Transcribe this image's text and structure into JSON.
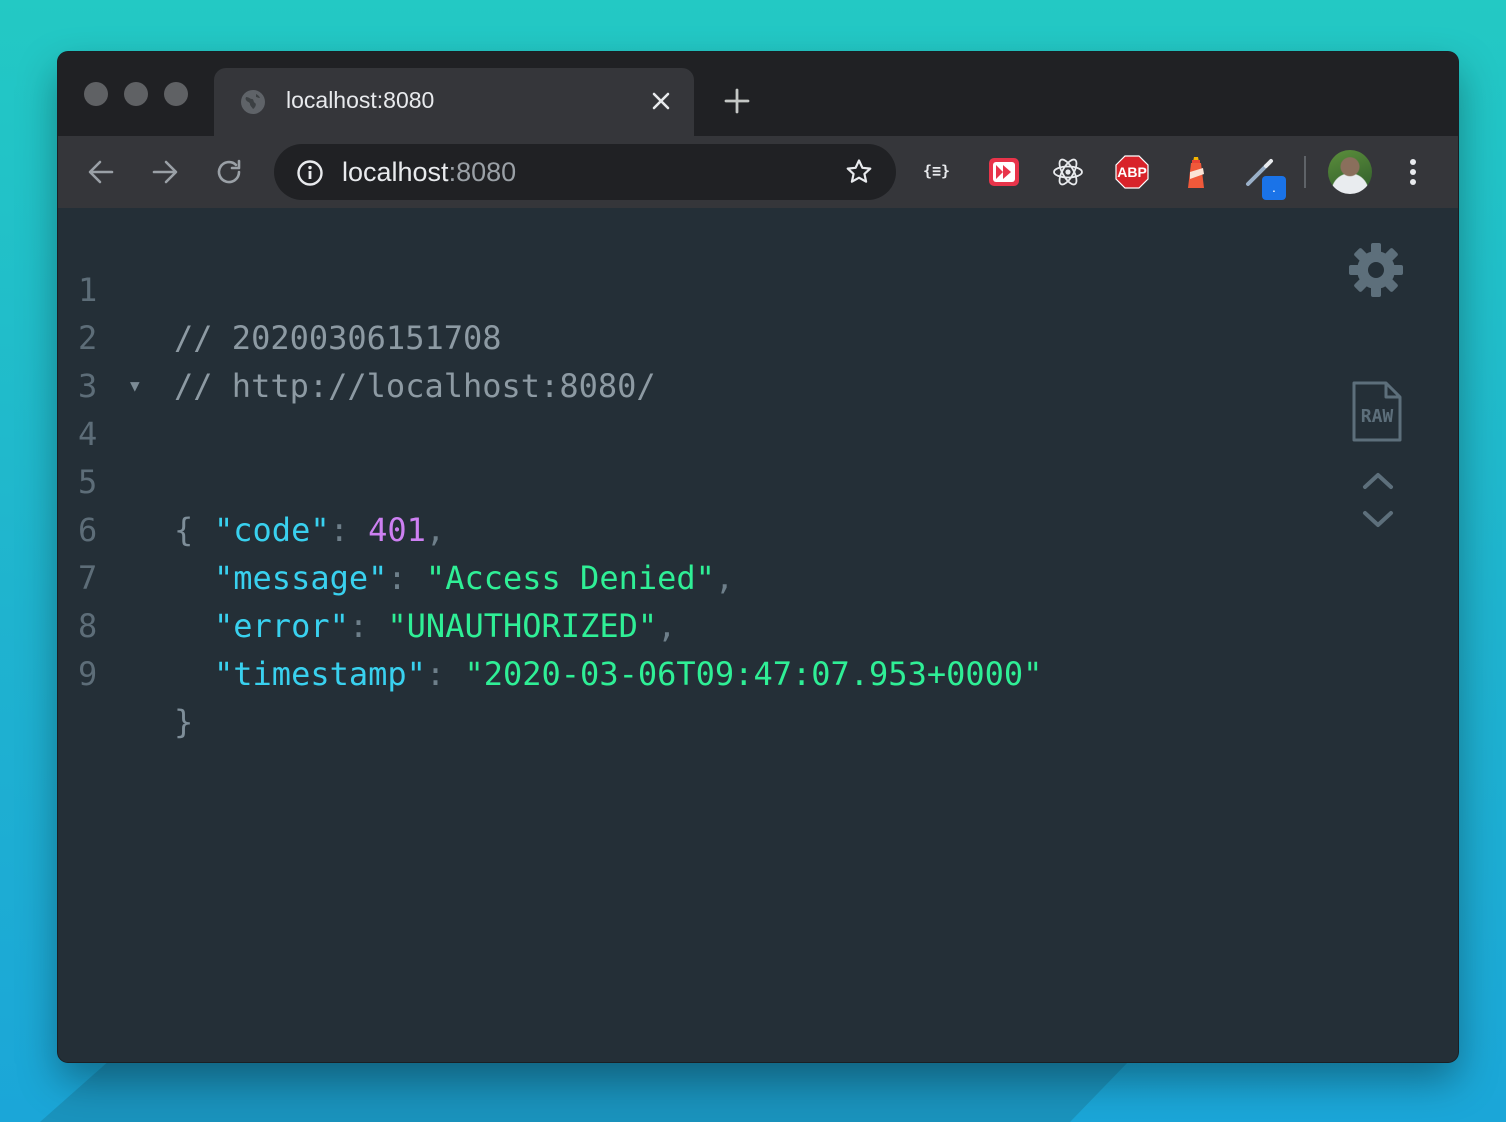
{
  "tab": {
    "title": "localhost:8080"
  },
  "omnibox": {
    "host": "localhost",
    "port": ":8080"
  },
  "extensions": [
    "json-formatter-icon",
    "video-speed-icon",
    "react-devtools-icon",
    "adblock-plus-icon",
    "lighthouse-icon",
    "color-picker-icon"
  ],
  "extension_labels": {
    "json": "{≡}",
    "abp": "ABP"
  },
  "side_tools": {
    "raw_label": "RAW"
  },
  "code_lines": [
    {
      "n": "1",
      "comment": "// 20200306151708"
    },
    {
      "n": "2",
      "comment": "// http://localhost:8080/"
    },
    {
      "n": "3"
    },
    {
      "n": "4",
      "open": "{"
    },
    {
      "n": "5",
      "key": "\"code\"",
      "colon": ": ",
      "value": "401",
      "comma": ","
    },
    {
      "n": "6",
      "key": "\"message\"",
      "colon": ": ",
      "value": "\"Access Denied\"",
      "comma": ","
    },
    {
      "n": "7",
      "key": "\"error\"",
      "colon": ": ",
      "value": "\"UNAUTHORIZED\"",
      "comma": ","
    },
    {
      "n": "8",
      "key": "\"timestamp\"",
      "colon": ": ",
      "value": "\"2020-03-06T09:47:07.953+0000\""
    },
    {
      "n": "9",
      "close": "}"
    }
  ],
  "colors": {
    "background": "#242f37",
    "key": "#39d1ef",
    "string": "#2fef96",
    "number": "#cd80f2",
    "comment": "#8d9aa3"
  }
}
